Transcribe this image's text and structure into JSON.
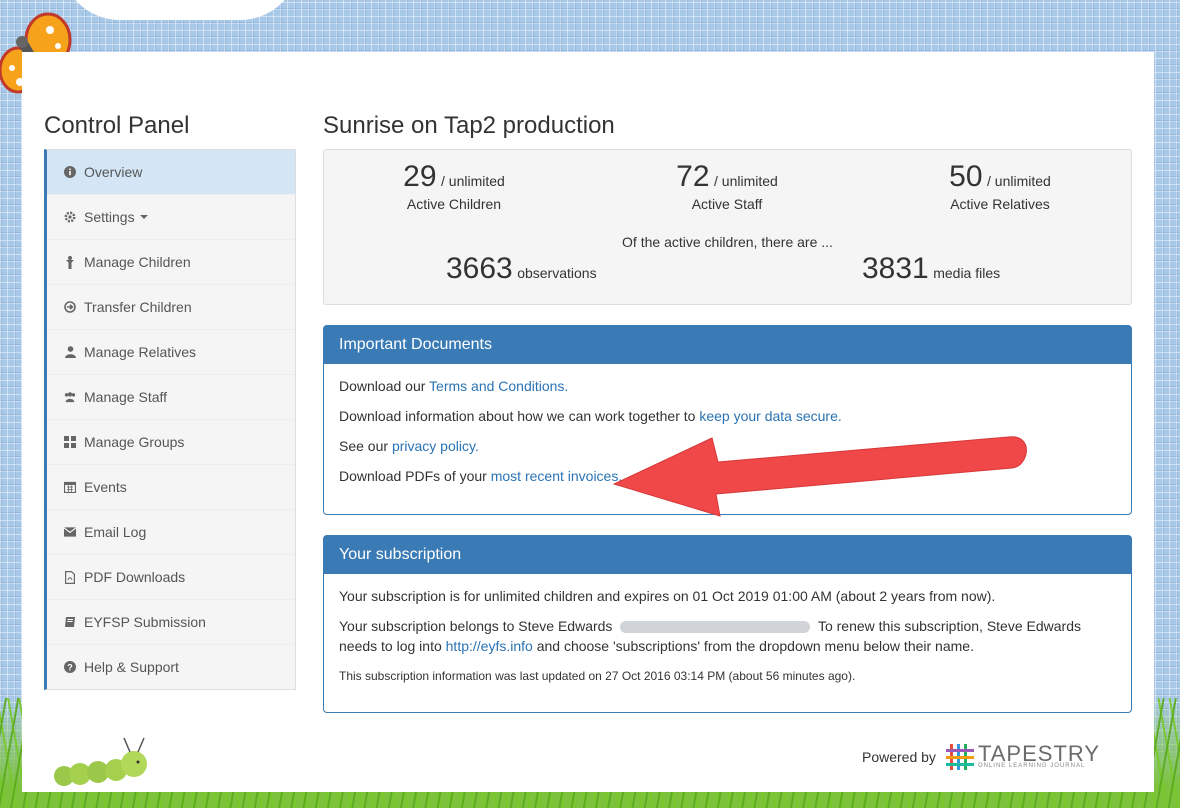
{
  "sidebar": {
    "title": "Control Panel",
    "items": [
      {
        "label": "Overview",
        "icon": "info-icon",
        "active": true
      },
      {
        "label": "Settings",
        "icon": "gear-icon",
        "dropdown": true
      },
      {
        "label": "Manage Children",
        "icon": "child-icon"
      },
      {
        "label": "Transfer Children",
        "icon": "transfer-icon"
      },
      {
        "label": "Manage Relatives",
        "icon": "user-icon"
      },
      {
        "label": "Manage Staff",
        "icon": "users-icon"
      },
      {
        "label": "Manage Groups",
        "icon": "grid-icon"
      },
      {
        "label": "Events",
        "icon": "calendar-icon"
      },
      {
        "label": "Email Log",
        "icon": "envelope-icon"
      },
      {
        "label": "PDF Downloads",
        "icon": "pdf-icon"
      },
      {
        "label": "EYFSP Submission",
        "icon": "book-icon"
      },
      {
        "label": "Help & Support",
        "icon": "question-icon"
      }
    ]
  },
  "main": {
    "title": "Sunrise on Tap2 production",
    "stats": {
      "children": {
        "value": "29",
        "unit": "/ unlimited",
        "label": "Active Children"
      },
      "staff": {
        "value": "72",
        "unit": "/ unlimited",
        "label": "Active Staff"
      },
      "relatives": {
        "value": "50",
        "unit": "/ unlimited",
        "label": "Active Relatives"
      },
      "subtext": "Of the active children, there are ...",
      "observations": {
        "value": "3663",
        "label": "observations"
      },
      "media": {
        "value": "3831",
        "label": "media files"
      }
    },
    "documents": {
      "heading": "Important Documents",
      "line1_text": "Download our",
      "line1_link": "Terms and Conditions.",
      "line2_text": "Download information about how we can work together to",
      "line2_link": "keep your data secure.",
      "line3_text": "See our",
      "line3_link": "privacy policy.",
      "line4_text": "Download PDFs of your",
      "line4_link": "most recent invoices."
    },
    "subscription": {
      "heading": "Your subscription",
      "line1": "Your subscription is for unlimited children and expires on 01 Oct 2019 01:00 AM (about 2 years from now).",
      "line2_pre": "Your subscription belongs to Steve Edwards",
      "line2_post": "To renew this subscription, Steve Edwards needs to log into",
      "line2_link": "http://eyfs.info",
      "line2_end": "and choose 'subscriptions' from the dropdown menu below their name.",
      "line3": "This subscription information was last updated on 27 Oct 2016 03:14 PM (about 56 minutes ago)."
    }
  },
  "footer": {
    "powered_by": "Powered by",
    "logo_text": "TAPESTRY",
    "logo_sub": "ONLINE LEARNING JOURNAL"
  },
  "colors": {
    "accent": "#3a7ab5",
    "link": "#2a73b5",
    "arrow": "#f04848"
  }
}
